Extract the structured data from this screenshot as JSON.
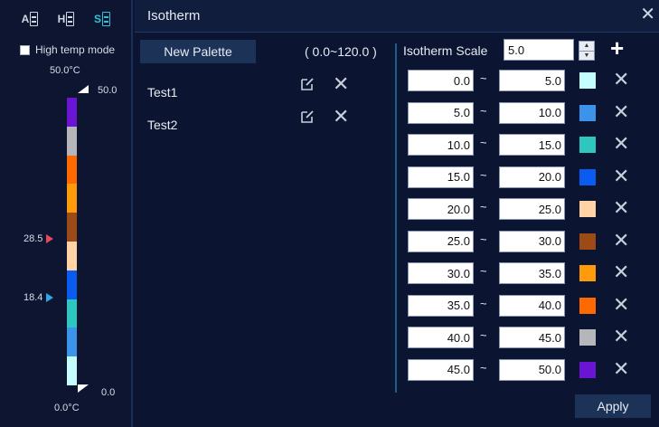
{
  "left_panel": {
    "modes": [
      {
        "letter": "A",
        "icon": "auto-range-icon",
        "active": false
      },
      {
        "letter": "H",
        "icon": "histogram-range-icon",
        "active": false
      },
      {
        "letter": "S",
        "icon": "scale-range-icon",
        "active": true
      }
    ],
    "high_temp_label": "High temp mode",
    "high_temp_checked": false,
    "max_temp": "50.0°C",
    "min_temp": "0.0°C",
    "range_top": "50.0",
    "range_bottom": "0.0",
    "markers": [
      {
        "value": "28.5",
        "color": "#e8485c"
      },
      {
        "value": "18.4",
        "color": "#2ea8e8"
      }
    ],
    "scale_colors": [
      "#6a14d4",
      "#b4b6ba",
      "#ff6a00",
      "#ff9a0a",
      "#9c4a16",
      "#ffd3a6",
      "#0a5cf0",
      "#2ec7c0",
      "#3b94ea",
      "#c5fdff"
    ]
  },
  "title": "Isotherm",
  "new_palette_label": "New Palette",
  "range_label": "( 0.0~120.0 )",
  "palettes": [
    {
      "name": "Test1"
    },
    {
      "name": "Test2"
    }
  ],
  "isotherm_scale_label": "Isotherm Scale",
  "isotherm_scale_value": "5.0",
  "isotherms": [
    {
      "from": "0.0",
      "to": "5.0",
      "color": "#c5fdff"
    },
    {
      "from": "5.0",
      "to": "10.0",
      "color": "#3b94ea"
    },
    {
      "from": "10.0",
      "to": "15.0",
      "color": "#2ec7c0"
    },
    {
      "from": "15.0",
      "to": "20.0",
      "color": "#0a5cf0"
    },
    {
      "from": "20.0",
      "to": "25.0",
      "color": "#ffd3a6"
    },
    {
      "from": "25.0",
      "to": "30.0",
      "color": "#9c4a16"
    },
    {
      "from": "30.0",
      "to": "35.0",
      "color": "#ff9a0a"
    },
    {
      "from": "35.0",
      "to": "40.0",
      "color": "#ff6a00"
    },
    {
      "from": "40.0",
      "to": "45.0",
      "color": "#b4b6ba"
    },
    {
      "from": "45.0",
      "to": "50.0",
      "color": "#6a14d4"
    }
  ],
  "apply_label": "Apply"
}
